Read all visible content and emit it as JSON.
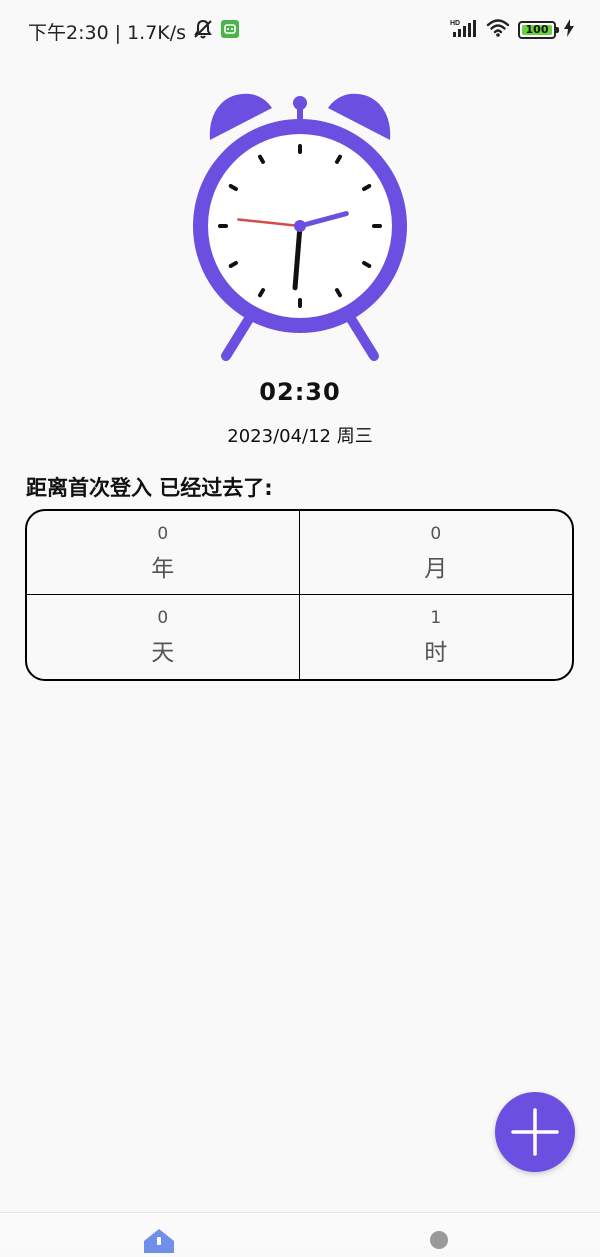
{
  "status_bar": {
    "time": "下午2:30",
    "separator": "|",
    "net_speed": "1.7K/s",
    "signal_label": "HD",
    "battery_level": "100",
    "icons": [
      "mute-icon",
      "app-notification-icon",
      "signal-icon",
      "wifi-icon",
      "battery-icon",
      "charging-icon"
    ]
  },
  "clock": {
    "time": "02:30",
    "date": "2023/04/12 周三",
    "accent_color": "#6a4fe0",
    "hour": 2,
    "minute": 30,
    "second": 46
  },
  "elapsed": {
    "heading": "距离首次登入 已经过去了:",
    "cells": [
      {
        "value": "0",
        "unit": "年"
      },
      {
        "value": "0",
        "unit": "月"
      },
      {
        "value": "0",
        "unit": "天"
      },
      {
        "value": "1",
        "unit": "时"
      }
    ]
  },
  "fab": {
    "icon": "plus-icon",
    "color": "#6a4fe0"
  },
  "bottom_nav": {
    "items": [
      {
        "icon": "home-icon",
        "color": "#6f8fe8"
      },
      {
        "icon": "dot-icon",
        "color": "#9a9a9a"
      }
    ]
  }
}
